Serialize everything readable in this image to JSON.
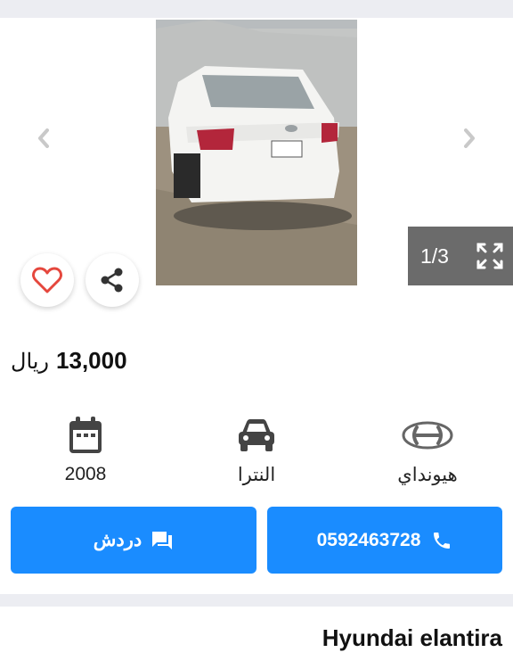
{
  "gallery": {
    "counter": "1/3",
    "image_alt": "white sedan rear view"
  },
  "icons": {
    "prev": "chevron-left-icon",
    "next": "chevron-right-icon",
    "fullscreen": "fullscreen-icon",
    "favorite": "heart-icon",
    "share": "share-icon",
    "calendar": "calendar-icon",
    "car": "car-icon",
    "brand": "hyundai-logo-icon",
    "chat": "chat-icon",
    "phone": "phone-icon"
  },
  "listing": {
    "price": "13,000",
    "currency": "ريال",
    "specs": {
      "year": "2008",
      "model": "النترا",
      "brand": "هيونداي"
    },
    "title": "Hyundai elantira"
  },
  "actions": {
    "chat_label": "دردش",
    "phone": "0592463728"
  },
  "colors": {
    "accent": "#1a8cff",
    "heart": "#e5473d",
    "divider": "#ecedf2"
  }
}
